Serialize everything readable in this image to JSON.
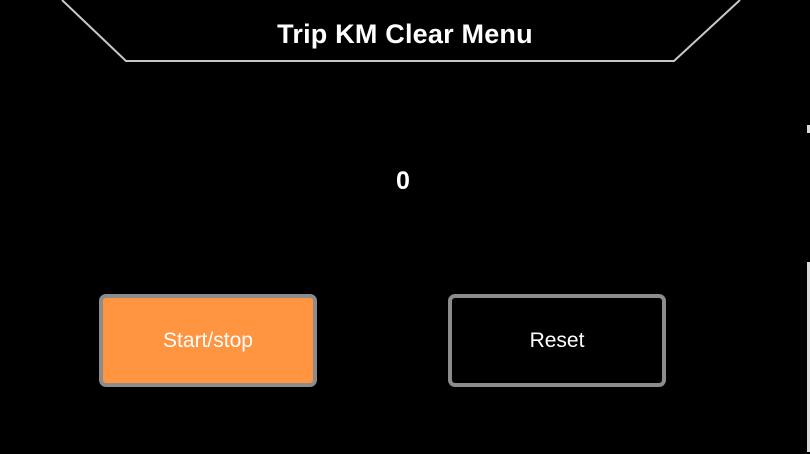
{
  "header": {
    "title": "Trip KM Clear Menu"
  },
  "trip": {
    "value": "0"
  },
  "buttons": {
    "start_stop_label": "Start/stop",
    "reset_label": "Reset"
  },
  "colors": {
    "background": "#000000",
    "accent": "#ff9441",
    "border": "#8c8c8c",
    "text": "#ffffff"
  }
}
